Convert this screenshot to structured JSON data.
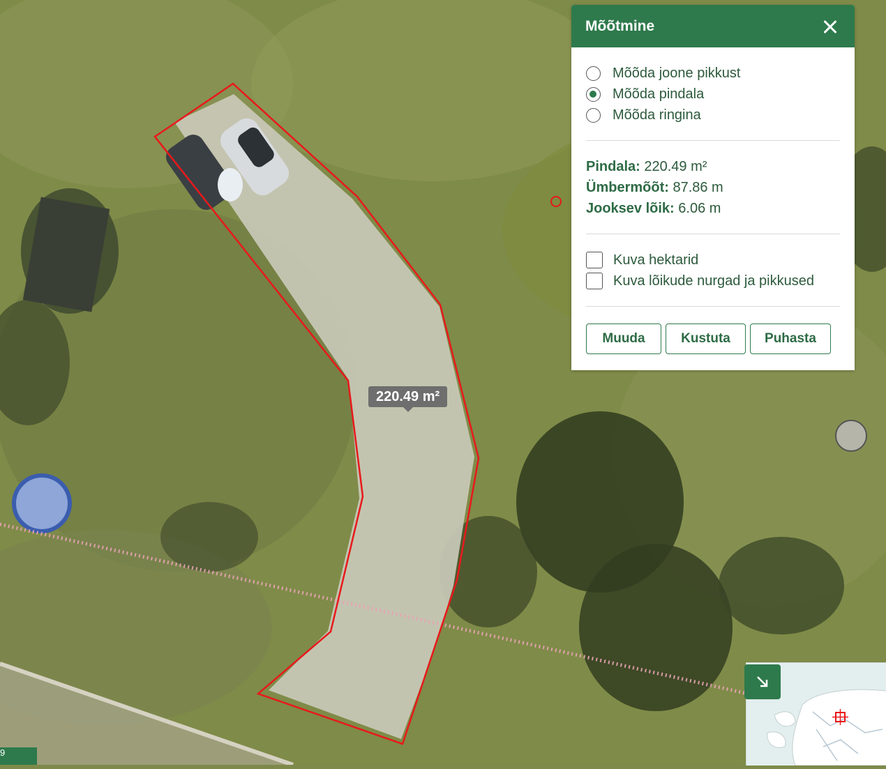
{
  "panel": {
    "title": "Mõõtmine",
    "modes": [
      {
        "label": "Mõõda joone pikkust",
        "selected": false
      },
      {
        "label": "Mõõda pindala",
        "selected": true
      },
      {
        "label": "Mõõda ringina",
        "selected": false
      }
    ],
    "stats": {
      "area_key": "Pindala:",
      "area_val": "220.49 m²",
      "perimeter_key": "Ümbermõõt:",
      "perimeter_val": "87.86 m",
      "segment_key": "Jooksev lõik:",
      "segment_val": "6.06 m"
    },
    "options": [
      {
        "label": "Kuva hektarid",
        "checked": false
      },
      {
        "label": "Kuva lõikude nurgad ja pikkused",
        "checked": false
      }
    ],
    "buttons": {
      "edit": "Muuda",
      "delete": "Kustuta",
      "clear": "Puhasta"
    }
  },
  "map": {
    "area_label": "220.49 m²",
    "polygon_color": "#e8191b",
    "accent": "#2e7a4c",
    "scale_tab_text": "9"
  }
}
